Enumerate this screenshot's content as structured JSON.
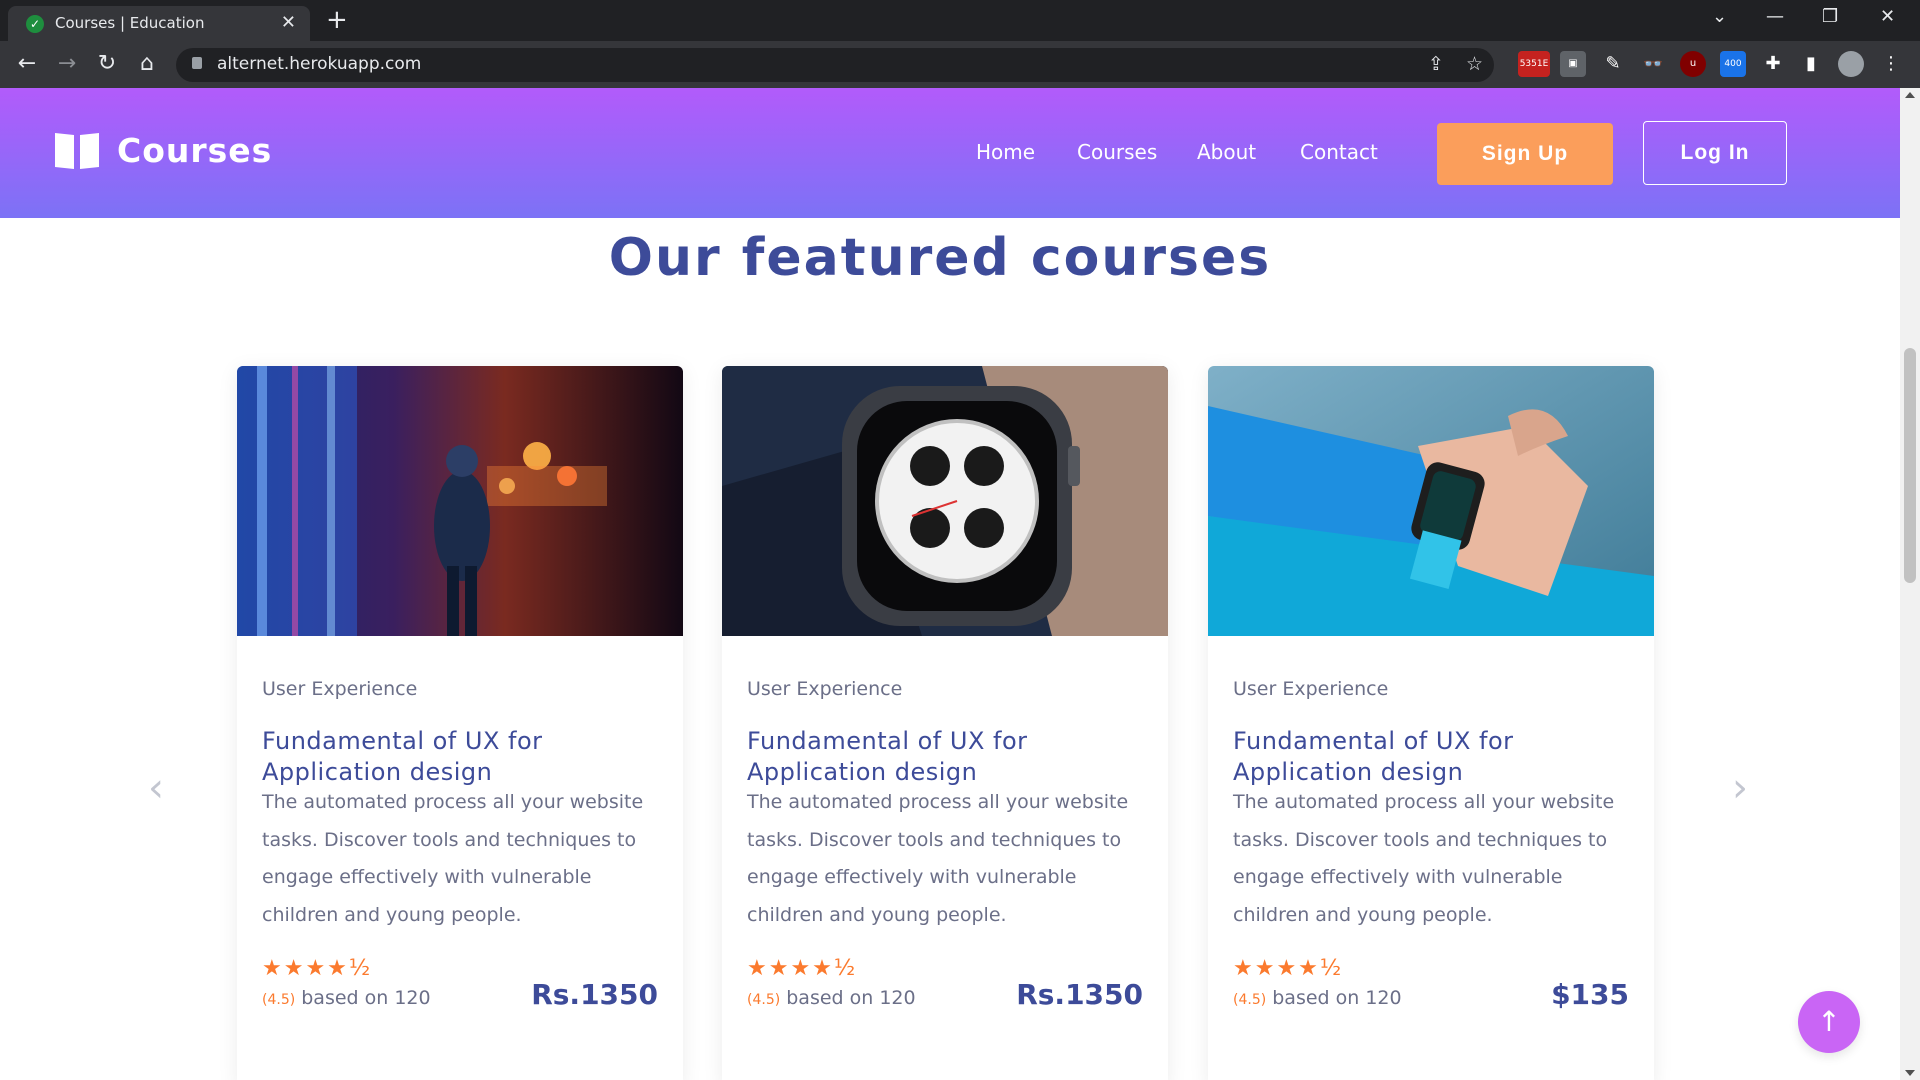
{
  "browser": {
    "tab_title": "Courses | Education",
    "url": "alternet.herokuapp.com",
    "ext_badges": [
      "5351E",
      "400"
    ]
  },
  "site": {
    "logo_text": "Courses",
    "nav": [
      "Home",
      "Courses",
      "About",
      "Contact"
    ],
    "signup_label": "Sign Up",
    "login_label": "Log In",
    "accent_color": "#fb9e5b",
    "brand_color": "#3d4b99"
  },
  "section": {
    "heading": "Our featured courses"
  },
  "courses": [
    {
      "image": "person-neon-lights",
      "category": "User Experience",
      "title": "Fundamental of UX for Application design",
      "description": "The automated process all your website tasks. Discover tools and techniques to engage effectively with vulnerable children and young people.",
      "stars": "★★★★½",
      "rating_value": "(4.5)",
      "rating_text": "based on 120",
      "price": "Rs.1350"
    },
    {
      "image": "smartwatch-closeup",
      "category": "User Experience",
      "title": "Fundamental of UX for Application design",
      "description": "The automated process all your website tasks. Discover tools and techniques to engage effectively with vulnerable children and young people.",
      "stars": "★★★★½",
      "rating_value": "(4.5)",
      "rating_text": "based on 120",
      "price": "Rs.1350"
    },
    {
      "image": "smartwatch-on-wrist",
      "category": "User Experience",
      "title": "Fundamental of UX for Application design",
      "description": "The automated process all your website tasks. Discover tools and techniques to engage effectively with vulnerable children and young people.",
      "stars": "★★★★½",
      "rating_value": "(4.5)",
      "rating_text": "based on 120",
      "price": "$135"
    }
  ]
}
